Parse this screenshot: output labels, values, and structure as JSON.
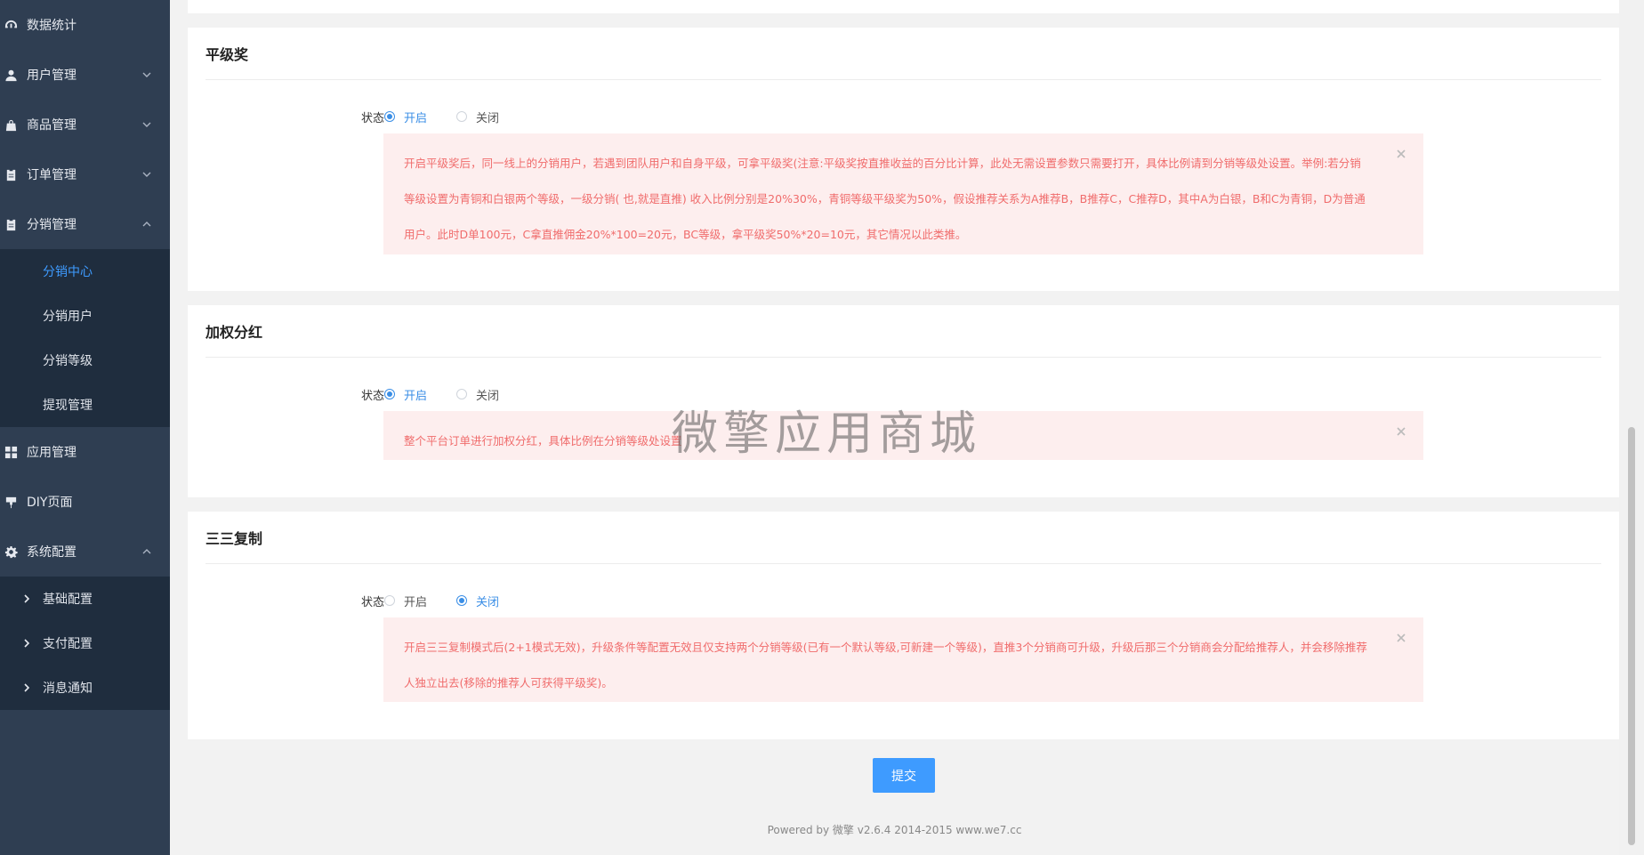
{
  "sidebar": {
    "items": [
      {
        "label": "数据统计",
        "icon": "dashboard-icon"
      },
      {
        "label": "用户管理",
        "icon": "user-icon"
      },
      {
        "label": "商品管理",
        "icon": "bag-icon"
      },
      {
        "label": "订单管理",
        "icon": "clipboard-icon"
      },
      {
        "label": "分销管理",
        "icon": "clipboard-icon"
      },
      {
        "label": "应用管理",
        "icon": "grid-icon"
      },
      {
        "label": "DIY页面",
        "icon": "brush-icon"
      },
      {
        "label": "系统配置",
        "icon": "gear-icon"
      }
    ],
    "distribution_sub": [
      {
        "label": "分销中心",
        "active": true
      },
      {
        "label": "分销用户",
        "active": false
      },
      {
        "label": "分销等级",
        "active": false
      },
      {
        "label": "提现管理",
        "active": false
      }
    ],
    "system_sub": [
      {
        "label": "基础配置"
      },
      {
        "label": "支付配置"
      },
      {
        "label": "消息通知"
      }
    ]
  },
  "sections": [
    {
      "title": "平级奖",
      "status_label": "状态",
      "on_label": "开启",
      "off_label": "关闭",
      "selected": "on",
      "alert": "开启平级奖后，同一线上的分销用户，若遇到团队用户和自身平级，可拿平级奖(注意:平级奖按直推收益的百分比计算，此处无需设置参数只需要打开，具体比例请到分销等级处设置。举例:若分销等级设置为青铜和白银两个等级，一级分销( 也,就是直推) 收入比例分别是20%30%，青铜等级平级奖为50%，假设推荐关系为A推荐B，B推荐C，C推荐D，其中A为白银，B和C为青铜，D为普通用户。此时D单100元，C拿直推佣金20%*100=20元，BC等级，拿平级奖50%*20=10元，其它情况以此类推。"
    },
    {
      "title": "加权分红",
      "status_label": "状态",
      "on_label": "开启",
      "off_label": "关闭",
      "selected": "on",
      "alert": "整个平台订单进行加权分红，具体比例在分销等级处设置"
    },
    {
      "title": "三三复制",
      "status_label": "状态",
      "on_label": "开启",
      "off_label": "关闭",
      "selected": "off",
      "alert": "开启三三复制模式后(2+1模式无效)，升级条件等配置无效且仅支持两个分销等级(已有一个默认等级,可新建一个等级)，直推3个分销商可升级，升级后那三个分销商会分配给推荐人，并会移除推荐人独立出去(移除的推荐人可获得平级奖)。"
    }
  ],
  "submit_label": "提交",
  "footer": "Powered by 微擎 v2.6.4 2014-2015 www.we7.cc",
  "watermark": "微擎应用商城",
  "colors": {
    "accent": "#3e9bff",
    "sidebar": "#2f3e52",
    "alert_bg": "#fdeeee",
    "alert_text": "#f06c6c"
  }
}
